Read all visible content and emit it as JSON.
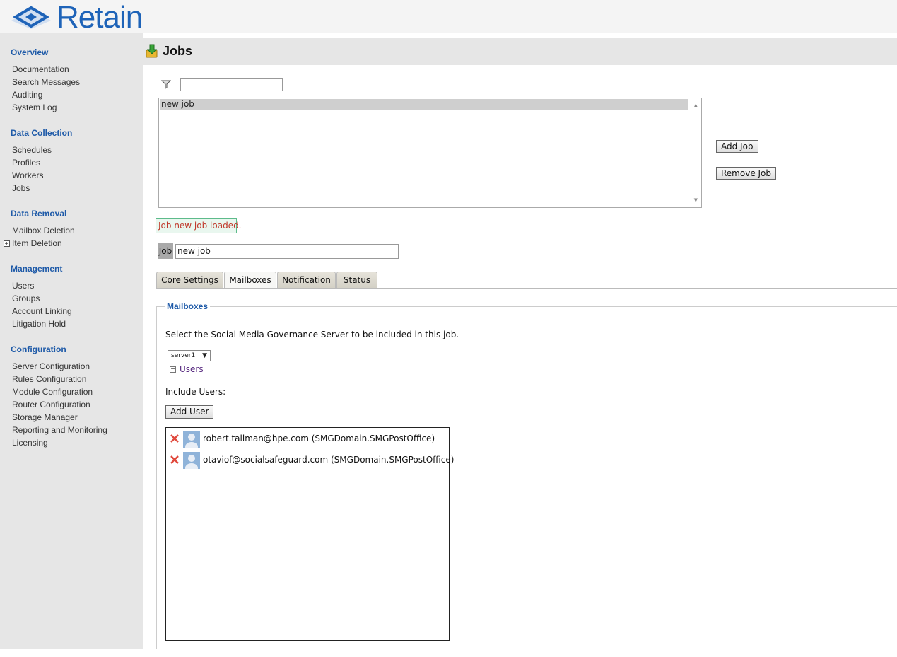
{
  "app": {
    "logo_text": "Retain",
    "brand_color": "#1e63b8"
  },
  "sidebar": {
    "sections": [
      {
        "label": "Overview",
        "items": [
          "Documentation",
          "Search Messages",
          "Auditing",
          "System Log"
        ]
      },
      {
        "label": "Data Collection",
        "items": [
          "Schedules",
          "Profiles",
          "Workers",
          "Jobs"
        ]
      },
      {
        "label": "Data Removal",
        "items": [
          "Mailbox Deletion",
          "Item Deletion"
        ]
      },
      {
        "label": "Management",
        "items": [
          "Users",
          "Groups",
          "Account Linking",
          "Litigation Hold"
        ]
      },
      {
        "label": "Configuration",
        "items": [
          "Server Configuration",
          "Rules Configuration",
          "Module Configuration",
          "Router Configuration",
          "Storage Manager",
          "Reporting and Monitoring",
          "Licensing"
        ]
      }
    ]
  },
  "page": {
    "title": "Jobs",
    "icon": "jobs-download-icon"
  },
  "filter": {
    "icon": "filter-icon",
    "value": ""
  },
  "job_list": {
    "items": [
      "new job"
    ],
    "selected": "new job"
  },
  "buttons": {
    "add_job": "Add Job",
    "remove_job": "Remove Job",
    "add_user": "Add User"
  },
  "status_message": "Job new job loaded.",
  "job_field": {
    "label": "Job",
    "value": "new job"
  },
  "tabs": [
    {
      "label": "Core Settings",
      "active": false
    },
    {
      "label": "Mailboxes",
      "active": true
    },
    {
      "label": "Notification",
      "active": false
    },
    {
      "label": "Status",
      "active": false
    }
  ],
  "mailboxes": {
    "legend": "Mailboxes",
    "description": "Select the Social Media Governance Server to be included in this job.",
    "server_select": {
      "selected": "server1"
    },
    "tree_node": "Users",
    "include_label": "Include Users:",
    "users": [
      {
        "address": "robert.tallman@hpe.com (SMGDomain.SMGPostOffice)"
      },
      {
        "address": "otaviof@socialsafeguard.com (SMGDomain.SMGPostOffice)"
      }
    ]
  }
}
